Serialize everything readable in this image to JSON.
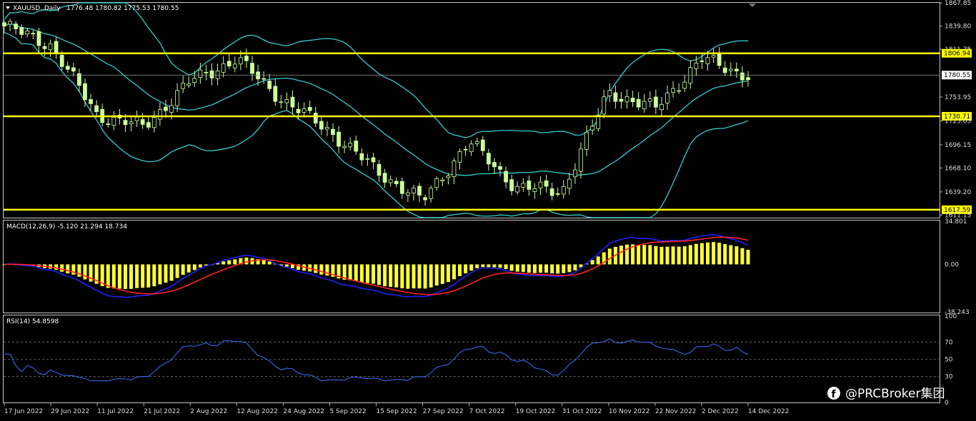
{
  "header": {
    "symbol": "XAUUSD.,Daily",
    "ohlc": "1776.48 1780.82 1775.53 1780.55"
  },
  "price_axis": {
    "ticks": [
      "1867.85",
      "1839.80",
      "1811.75",
      "1806.94",
      "1780.55",
      "1753.95",
      "1730.71",
      "1725.05",
      "1696.15",
      "1668.10",
      "1639.20",
      "1617.59",
      "1611.15"
    ]
  },
  "hlines": [
    {
      "value": 1806.94,
      "label": "1806.94",
      "color": "#ffff00"
    },
    {
      "value": 1730.71,
      "label": "1730.71",
      "color": "#ffff00"
    },
    {
      "value": 1617.59,
      "label": "1617.59",
      "color": "#ffff00"
    }
  ],
  "current_price": {
    "value": 1780.55,
    "label": "1780.55"
  },
  "macd": {
    "label": "MACD(12,26,9) -5.120 21.294 18.734",
    "ticks": [
      "34.801",
      "0.00",
      "-38.243"
    ]
  },
  "rsi": {
    "label": "RSI(14) 54.8598",
    "ticks": [
      "100",
      "70",
      "50",
      "30",
      "0"
    ]
  },
  "time_axis": [
    "17 Jun 2022",
    "29 Jun 2022",
    "11 Jul 2022",
    "21 Jul 2022",
    "2 Aug 2022",
    "12 Aug 2022",
    "24 Aug 2022",
    "5 Sep 2022",
    "15 Sep 2022",
    "27 Sep 2022",
    "7 Oct 2022",
    "19 Oct 2022",
    "31 Oct 2022",
    "10 Nov 2022",
    "22 Nov 2022",
    "2 Dec 2022",
    "14 Dec 2022"
  ],
  "watermark": "@PRCBroker集团",
  "colors": {
    "bull": "#ccff99",
    "bear": "#ccff99",
    "band": "#33cccc",
    "level": "#ffff00",
    "macd_hist": "#ffff33",
    "macd_main": "#1f1fff",
    "macd_signal": "#ff2222",
    "rsi": "#3f6fff"
  },
  "chart_data": {
    "type": "candlestick",
    "title": "XAUUSD., Daily",
    "close_series": [
      {
        "date": "17 Jun 2022",
        "close": 1840
      },
      {
        "date": "29 Jun 2022",
        "close": 1817
      },
      {
        "date": "11 Jul 2022",
        "close": 1732
      },
      {
        "date": "21 Jul 2022",
        "close": 1718
      },
      {
        "date": "2 Aug 2022",
        "close": 1773
      },
      {
        "date": "12 Aug 2022",
        "close": 1800
      },
      {
        "date": "24 Aug 2022",
        "close": 1750
      },
      {
        "date": "5 Sep 2022",
        "close": 1713
      },
      {
        "date": "15 Sep 2022",
        "close": 1665
      },
      {
        "date": "27 Sep 2022",
        "close": 1628
      },
      {
        "date": "7 Oct 2022",
        "close": 1700
      },
      {
        "date": "19 Oct 2022",
        "close": 1645
      },
      {
        "date": "31 Oct 2022",
        "close": 1640
      },
      {
        "date": "10 Nov 2022",
        "close": 1760
      },
      {
        "date": "22 Nov 2022",
        "close": 1740
      },
      {
        "date": "2 Dec 2022",
        "close": 1800
      },
      {
        "date": "14 Dec 2022",
        "close": 1780
      }
    ],
    "ylim": [
      1608,
      1868
    ]
  }
}
